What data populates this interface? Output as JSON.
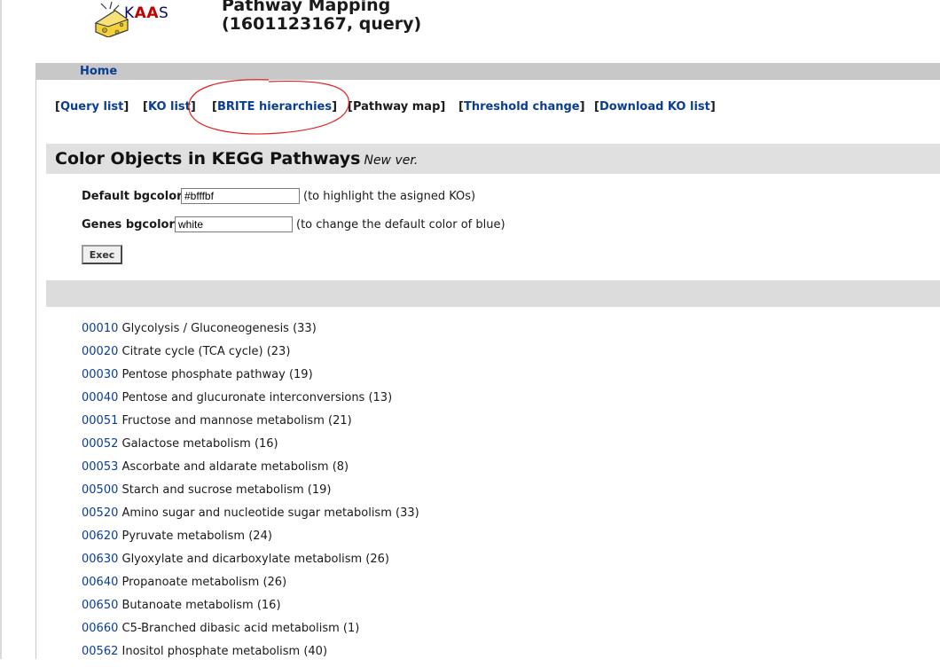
{
  "logo": {
    "k": "K",
    "aa": "AA",
    "s": "S"
  },
  "title": {
    "line1": "Pathway Mapping",
    "line2": "(1601123167, query)"
  },
  "home": {
    "label": "Home"
  },
  "nav": {
    "items": [
      {
        "label": "Query list"
      },
      {
        "label": "KO list"
      },
      {
        "label": "BRITE hierarchies"
      },
      {
        "label": "Pathway map"
      },
      {
        "label": "Threshold change"
      },
      {
        "label": "Download KO list"
      }
    ],
    "annotation_color": "#e02020"
  },
  "section": {
    "title": "Color Objects in KEGG Pathways",
    "badge": "New ver."
  },
  "form": {
    "default_bgcolor": {
      "label": "Default bgcolor:",
      "value": "#bfffbf",
      "hint": "(to highlight the asigned KOs)"
    },
    "genes_bgcolor": {
      "label": "Genes bgcolor:",
      "value": "white",
      "hint": "(to change the default color of blue)"
    },
    "exec_label": "Exec"
  },
  "pathways": [
    {
      "code": "00010",
      "name": "Glycolysis / Gluconeogenesis (33)"
    },
    {
      "code": "00020",
      "name": "Citrate cycle (TCA cycle) (23)"
    },
    {
      "code": "00030",
      "name": "Pentose phosphate pathway (19)"
    },
    {
      "code": "00040",
      "name": "Pentose and glucuronate interconversions (13)"
    },
    {
      "code": "00051",
      "name": "Fructose and mannose metabolism (21)"
    },
    {
      "code": "00052",
      "name": "Galactose metabolism (16)"
    },
    {
      "code": "00053",
      "name": "Ascorbate and aldarate metabolism (8)"
    },
    {
      "code": "00500",
      "name": "Starch and sucrose metabolism (19)"
    },
    {
      "code": "00520",
      "name": "Amino sugar and nucleotide sugar metabolism (33)"
    },
    {
      "code": "00620",
      "name": "Pyruvate metabolism (24)"
    },
    {
      "code": "00630",
      "name": "Glyoxylate and dicarboxylate metabolism (26)"
    },
    {
      "code": "00640",
      "name": "Propanoate metabolism (26)"
    },
    {
      "code": "00650",
      "name": "Butanoate metabolism (16)"
    },
    {
      "code": "00660",
      "name": "C5-Branched dibasic acid metabolism (1)"
    },
    {
      "code": "00562",
      "name": "Inositol phosphate metabolism (40)"
    }
  ]
}
